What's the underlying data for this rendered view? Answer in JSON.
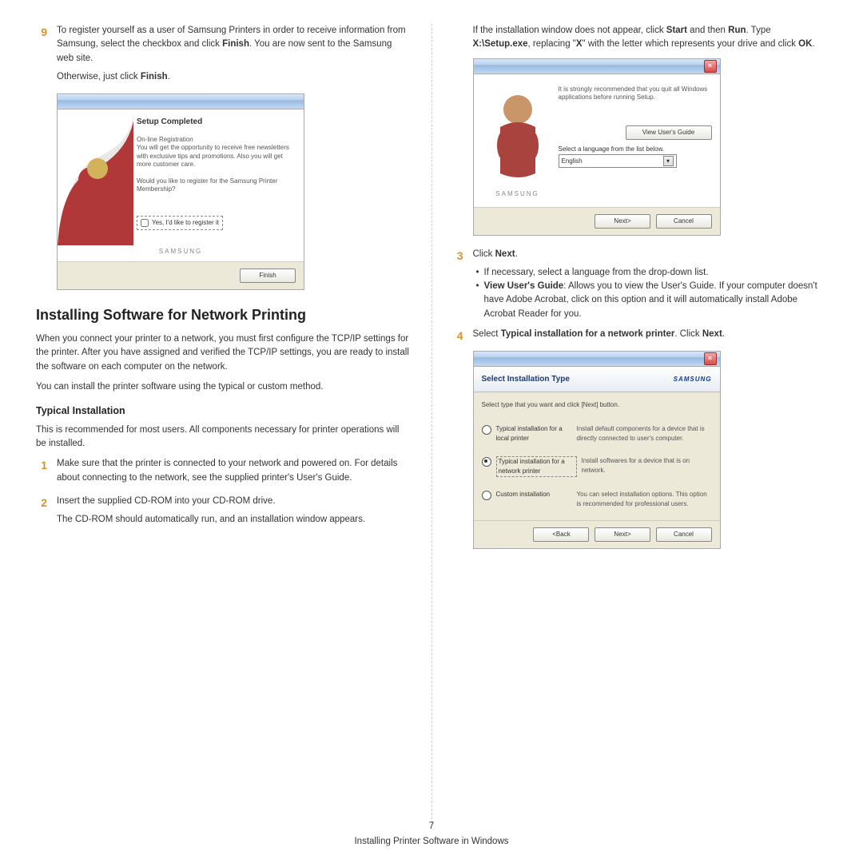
{
  "left": {
    "step9": {
      "num": "9",
      "text1a": "To register yourself as a user of Samsung Printers in order to receive information from Samsung, select the checkbox and click ",
      "finish1": "Finish",
      "text1b": ". You are now sent to the Samsung web site.",
      "text2a": "Otherwise, just click ",
      "finish2": "Finish",
      "text2b": "."
    },
    "dlg1": {
      "heading": "Setup Completed",
      "reg_h": "On-line Registration",
      "reg_t": "You will get the opportunity to receive free newsletters with exclusive tips and promotions. Also you will get more customer care.",
      "prompt": "Would you like to register for the Samsung Printer Membership?",
      "check": "Yes, I'd like to register it",
      "brand": "SAMSUNG",
      "btn": "Finish"
    },
    "h2": "Installing Software for Network Printing",
    "p1": "When you connect your printer to a network, you must first configure the TCP/IP settings for the printer. After you have assigned and verified the TCP/IP settings, you are ready to install the software on each computer on the network.",
    "p2": "You can install the printer software using the typical or custom method.",
    "h3": "Typical Installation",
    "p3": "This is recommended for most users. All components necessary for printer operations will be installed.",
    "step1": {
      "num": "1",
      "text": "Make sure that the printer is connected to your network and powered on. For details about connecting to the network, see the supplied printer's User's Guide."
    },
    "step2": {
      "num": "2",
      "text1": "Insert the supplied CD-ROM into your CD-ROM drive.",
      "text2": "The CD-ROM should automatically run, and an installation window appears."
    }
  },
  "right": {
    "cont": {
      "a": "If the installation window does not appear, click ",
      "start": "Start",
      "b": " and then ",
      "run": "Run",
      "c": ". Type ",
      "path": "X:\\Setup.exe",
      "d": ", replacing \"",
      "x": "X",
      "e": "\" with the letter which represents your drive and click ",
      "ok": "OK",
      "f": "."
    },
    "dlg2": {
      "msg": "It is strongly recommended that you quit all Windows applications before running Setup.",
      "viewbtn": "View User's Guide",
      "lang_label": "Select a language from the list below.",
      "lang_value": "English",
      "brand": "SAMSUNG",
      "next": "Next>",
      "cancel": "Cancel"
    },
    "step3": {
      "num": "3",
      "a": "Click ",
      "next": "Next",
      "b": ".",
      "bullet1": "If necessary, select a language from the drop-down list.",
      "bullet2_bold": "View User's Guide",
      "bullet2_rest": ": Allows you to view the User's Guide. If your computer doesn't have Adobe Acrobat, click on this option and it will automatically install Adobe Acrobat Reader for you."
    },
    "step4": {
      "num": "4",
      "a": "Select ",
      "bold": "Typical installation for a network printer",
      "b": ". Click ",
      "next": "Next",
      "c": "."
    },
    "dlg3": {
      "title": "Select Installation Type",
      "brand": "SAMSUNG",
      "note": "Select type that you want and click [Next] button.",
      "opt1_l": "Typical installation for a local printer",
      "opt1_d": "Install default components for a device that is directly connected to user's computer.",
      "opt2_l": "Typical installation for a network printer",
      "opt2_d": "Install softwares for a device that is on network.",
      "opt3_l": "Custom installation",
      "opt3_d": "You can select installation options. This option is recommended for professional users.",
      "back": "<Back",
      "next": "Next>",
      "cancel": "Cancel"
    }
  },
  "footer": {
    "page": "7",
    "title": "Installing Printer Software in Windows"
  }
}
